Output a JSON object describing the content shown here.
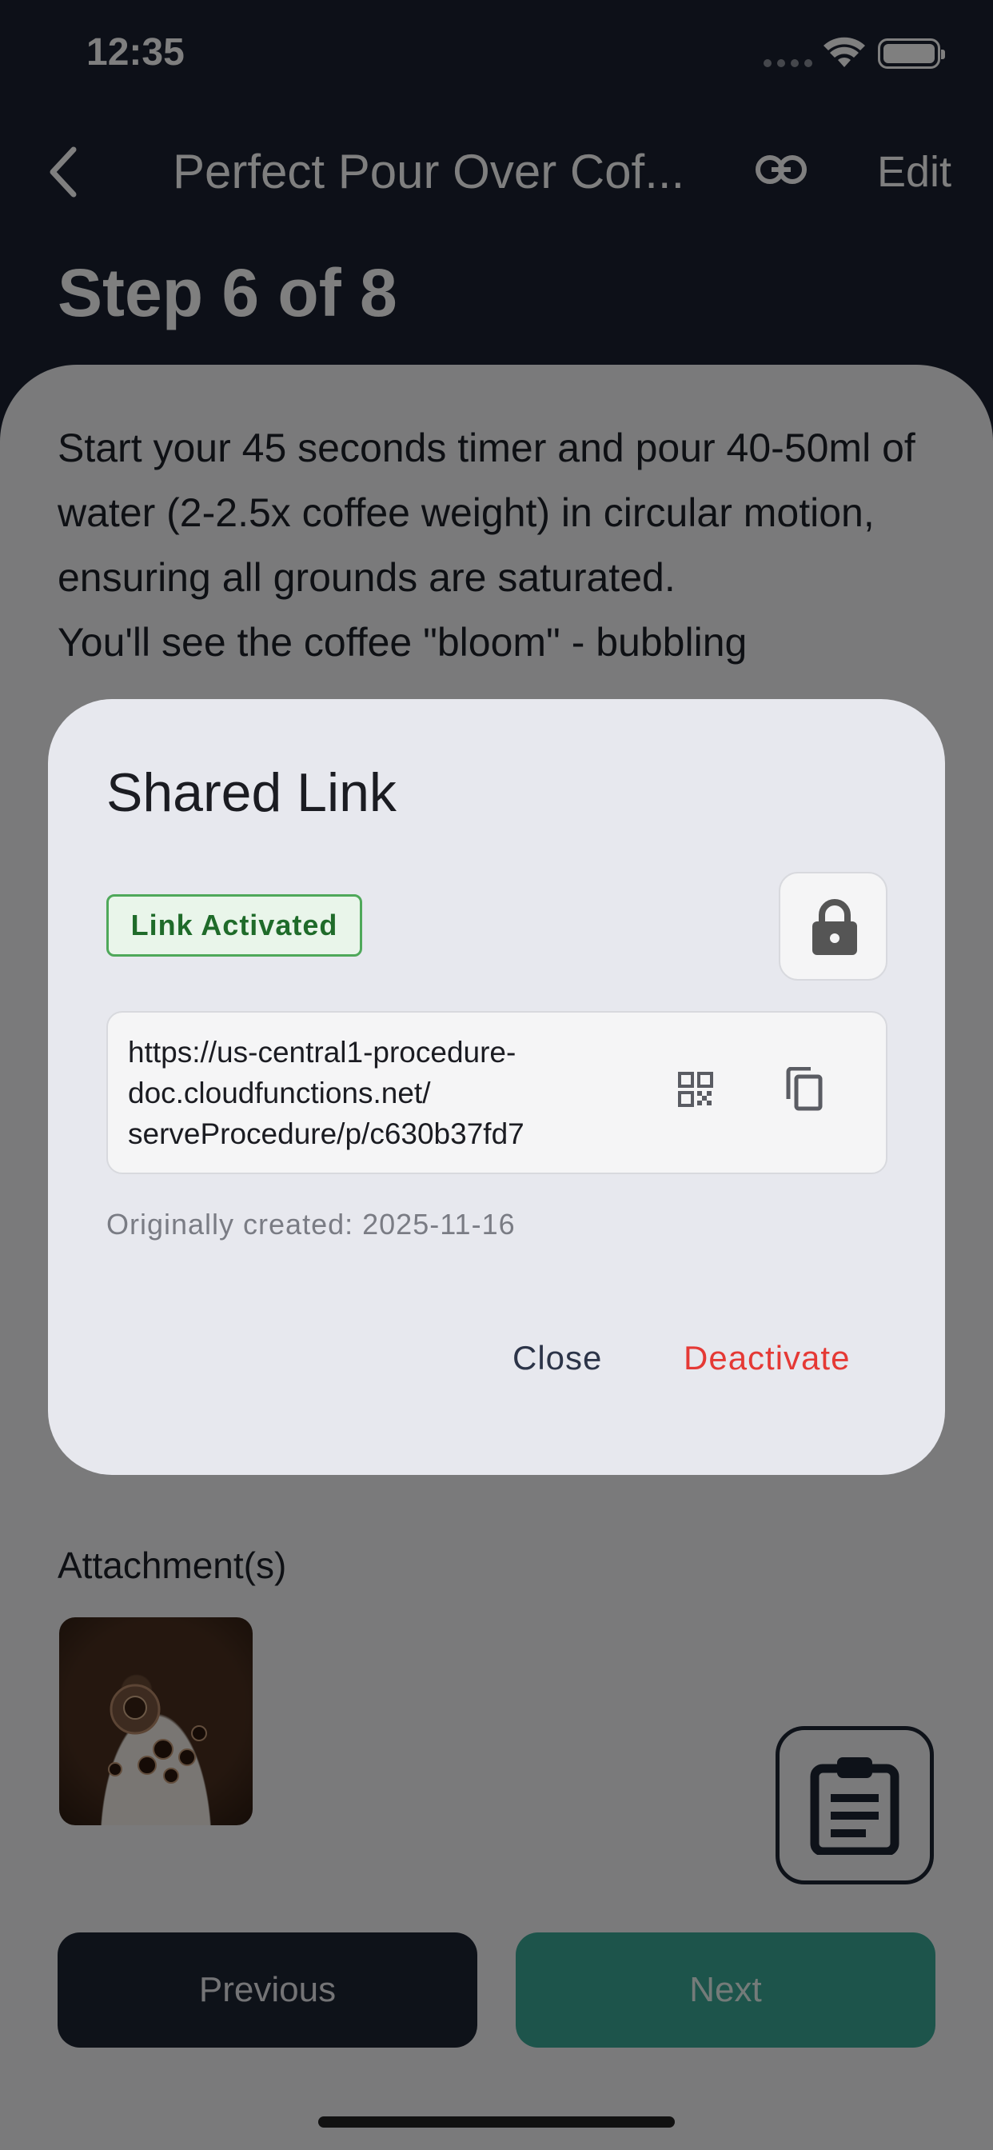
{
  "status_bar": {
    "time": "12:35"
  },
  "nav": {
    "back_icon": "chevron-left-icon",
    "title": "Perfect Pour Over Cof...",
    "link_icon": "link-icon",
    "edit_label": "Edit"
  },
  "step": {
    "title": "Step 6 of 8"
  },
  "instruction": {
    "lines": [
      "Start your 45 seconds timer and pour 40-50ml of water (2-2.5x coffee weight) in circular motion, ensuring all grounds are saturated.",
      "You'll see the coffee \"bloom\" - bubbling"
    ]
  },
  "attachments": {
    "label": "Attachment(s)"
  },
  "footer": {
    "previous_label": "Previous",
    "next_label": "Next"
  },
  "dialog": {
    "title": "Shared Link",
    "status_badge": "Link Activated",
    "url_lines": [
      "https://us-central1-procedure-",
      "doc.cloudfunctions.net/",
      "serveProcedure/p/c630b37fd7"
    ],
    "created": "Originally created: 2025-11-16",
    "close_label": "Close",
    "deactivate_label": "Deactivate"
  },
  "colors": {
    "header_bg": "#1b2130",
    "accent_green": "#3aa896",
    "danger": "#e53935",
    "badge_green": "#4fa85a"
  }
}
